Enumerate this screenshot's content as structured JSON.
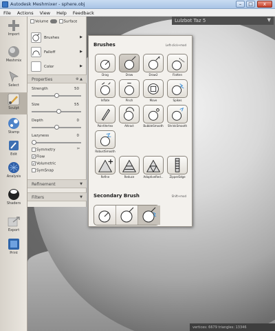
{
  "window": {
    "title": "Autodesk Meshmixer - sphere.obj",
    "min": "–",
    "max": "□",
    "close": "x"
  },
  "menu": [
    "File",
    "Actions",
    "View",
    "Help",
    "Feedback"
  ],
  "toolbar": [
    {
      "label": "Import",
      "icon": "plus-icon"
    },
    {
      "label": "Meshmix",
      "icon": "meshmix-icon"
    },
    {
      "label": "Select",
      "icon": "select-arrow-icon"
    },
    {
      "label": "Sculpt",
      "icon": "brush-icon",
      "active": true
    },
    {
      "label": "Stamp",
      "icon": "stamp-icon"
    },
    {
      "label": "Edit",
      "icon": "edit-icon"
    },
    {
      "label": "Analysis",
      "icon": "analysis-icon"
    },
    {
      "label": "Shaders",
      "icon": "shaders-icon"
    },
    {
      "label": "Export",
      "icon": "export-icon"
    },
    {
      "label": "Print",
      "icon": "print-icon"
    }
  ],
  "panel": {
    "volume": "Volume",
    "surface": "Surface",
    "brushes": "Brushes",
    "falloff": "Falloff",
    "color": "Color",
    "properties": "Properties",
    "strength_label": "Strength",
    "strength_val": "50",
    "strength": 0.5,
    "size_label": "Size",
    "size_val": "55",
    "size": 0.55,
    "depth_label": "Depth",
    "depth_val": "0",
    "depth": 0.5,
    "lazyness_label": "Lazyness",
    "lazyness_val": "0",
    "lazyness": 0.0,
    "symmetry": "Symmetry",
    "flow": "Flow",
    "volumetric": "Volumetric",
    "symsnap": "SymSnap",
    "refinement": "Refinement",
    "filters": "Filters"
  },
  "popup": {
    "title": "Brushes",
    "hint1": "Left-click+mod",
    "brushes": [
      "Drag",
      "Draw",
      "Draw2",
      "Flatten",
      "Inflate",
      "Pinch",
      "Move",
      "Spikes",
      "PaintVertex",
      "Attract",
      "BubbleSmooth",
      "ShrinkSmooth",
      "RobustSmooth",
      "Refine",
      "Reduce",
      "AdaptiveRed...",
      "ZipperEdge"
    ],
    "secondary": "Secondary Brush",
    "hint2": "Shift+mod"
  },
  "viewport": {
    "printer": "Lulzbot Taz 5",
    "status": "vertices: 6679  triangles: 13346"
  },
  "colors": {
    "accent": "#1f78d1",
    "spike_blue": "#3a8fd8"
  }
}
